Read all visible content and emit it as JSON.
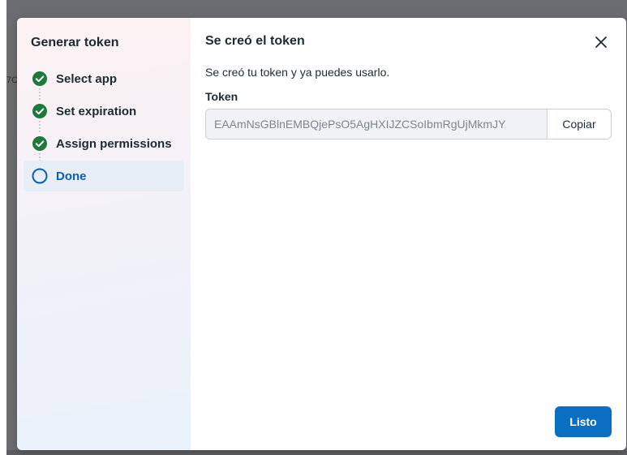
{
  "background": {
    "partial_text": "7C"
  },
  "sidebar": {
    "title": "Generar token",
    "steps": [
      {
        "label": "Select app",
        "status": "completed",
        "icon": "check-circle-icon"
      },
      {
        "label": "Set expiration",
        "status": "completed",
        "icon": "check-circle-icon"
      },
      {
        "label": "Assign permissions",
        "status": "completed",
        "icon": "check-circle-icon"
      },
      {
        "label": "Done",
        "status": "current",
        "icon": "circle-outline-icon"
      }
    ]
  },
  "main": {
    "title": "Se creó el token",
    "close_icon": "close-icon",
    "description": "Se creó tu token y ya puedes usarlo.",
    "token_label": "Token",
    "token_value": "EAAmNsGBlnEMBQjePsO5AgHXIJZCSoIbmRgUjMkmJY",
    "copy_label": "Copiar",
    "done_label": "Listo"
  },
  "colors": {
    "completed_step": "#1e7a3c",
    "current_step": "#0a5fae",
    "primary_button": "#0a6fc2",
    "overlay": "#6b6d70"
  }
}
